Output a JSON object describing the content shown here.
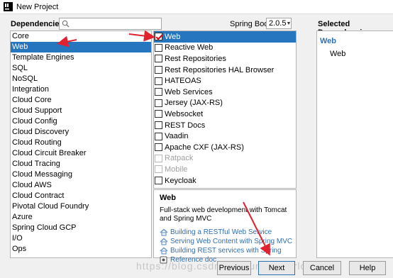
{
  "window": {
    "title": "New Project"
  },
  "header": {
    "dependencies_label": "Dependencies",
    "search": {
      "value": "",
      "placeholder": ""
    },
    "spring_boot_label": "Spring Boot",
    "spring_boot_version": "2.0.5",
    "selected_dependencies_label": "Selected Dependencies"
  },
  "categories": [
    {
      "label": "Core",
      "selected": false
    },
    {
      "label": "Web",
      "selected": true
    },
    {
      "label": "Template Engines",
      "selected": false
    },
    {
      "label": "SQL",
      "selected": false
    },
    {
      "label": "NoSQL",
      "selected": false
    },
    {
      "label": "Integration",
      "selected": false
    },
    {
      "label": "Cloud Core",
      "selected": false
    },
    {
      "label": "Cloud Support",
      "selected": false
    },
    {
      "label": "Cloud Config",
      "selected": false
    },
    {
      "label": "Cloud Discovery",
      "selected": false
    },
    {
      "label": "Cloud Routing",
      "selected": false
    },
    {
      "label": "Cloud Circuit Breaker",
      "selected": false
    },
    {
      "label": "Cloud Tracing",
      "selected": false
    },
    {
      "label": "Cloud Messaging",
      "selected": false
    },
    {
      "label": "Cloud AWS",
      "selected": false
    },
    {
      "label": "Cloud Contract",
      "selected": false
    },
    {
      "label": "Pivotal Cloud Foundry",
      "selected": false
    },
    {
      "label": "Azure",
      "selected": false
    },
    {
      "label": "Spring Cloud GCP",
      "selected": false
    },
    {
      "label": "I/O",
      "selected": false
    },
    {
      "label": "Ops",
      "selected": false
    }
  ],
  "dependencies": [
    {
      "label": "Web",
      "checked": true,
      "selected": true,
      "disabled": false
    },
    {
      "label": "Reactive Web",
      "checked": false,
      "selected": false,
      "disabled": false
    },
    {
      "label": "Rest Repositories",
      "checked": false,
      "selected": false,
      "disabled": false
    },
    {
      "label": "Rest Repositories HAL Browser",
      "checked": false,
      "selected": false,
      "disabled": false
    },
    {
      "label": "HATEOAS",
      "checked": false,
      "selected": false,
      "disabled": false
    },
    {
      "label": "Web Services",
      "checked": false,
      "selected": false,
      "disabled": false
    },
    {
      "label": "Jersey (JAX-RS)",
      "checked": false,
      "selected": false,
      "disabled": false
    },
    {
      "label": "Websocket",
      "checked": false,
      "selected": false,
      "disabled": false
    },
    {
      "label": "REST Docs",
      "checked": false,
      "selected": false,
      "disabled": false
    },
    {
      "label": "Vaadin",
      "checked": false,
      "selected": false,
      "disabled": false
    },
    {
      "label": "Apache CXF (JAX-RS)",
      "checked": false,
      "selected": false,
      "disabled": false
    },
    {
      "label": "Ratpack",
      "checked": false,
      "selected": false,
      "disabled": true
    },
    {
      "label": "Mobile",
      "checked": false,
      "selected": false,
      "disabled": true
    },
    {
      "label": "Keycloak",
      "checked": false,
      "selected": false,
      "disabled": false
    }
  ],
  "description": {
    "title": "Web",
    "text": "Full-stack web development with Tomcat and Spring MVC",
    "links": [
      {
        "label": "Building a RESTful Web Service",
        "icon": "guide-icon"
      },
      {
        "label": "Serving Web Content with Spring MVC",
        "icon": "guide-icon"
      },
      {
        "label": "Building REST services with Spring",
        "icon": "guide-icon"
      },
      {
        "label": "Reference doc",
        "icon": "doc-icon"
      }
    ]
  },
  "selected_dependencies": {
    "group": "Web",
    "items": [
      "Web"
    ]
  },
  "buttons": {
    "previous": "Previous",
    "next": "Next",
    "cancel": "Cancel",
    "help": "Help"
  },
  "watermark": "https://blog.csdn.net/sunforeverlove",
  "colors": {
    "selection": "#2675bf",
    "link": "#2f6fb3",
    "annotation_arrow": "#e0212e"
  }
}
